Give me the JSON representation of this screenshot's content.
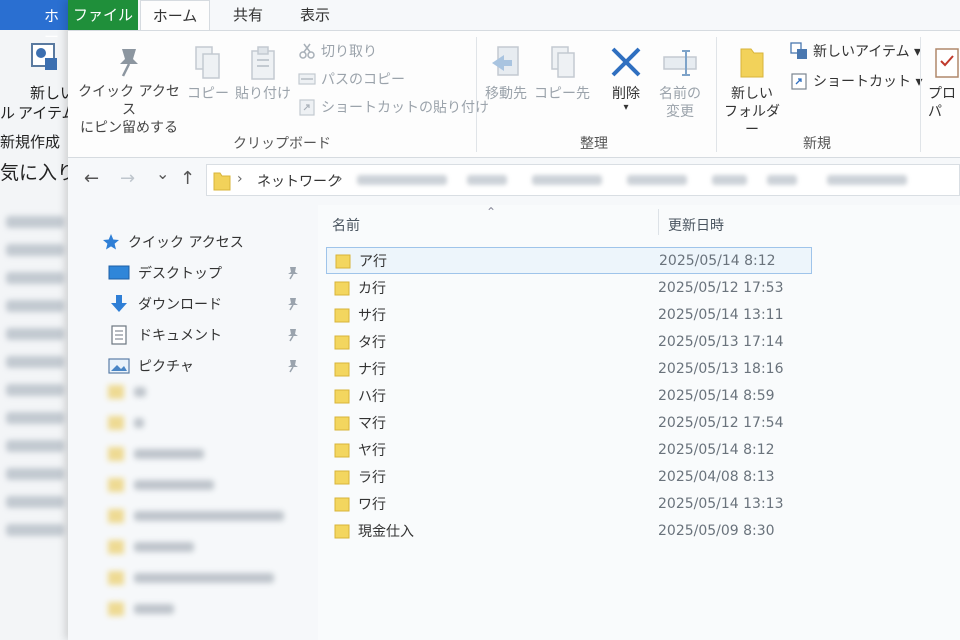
{
  "background_window": {
    "tab_label": "ホー",
    "button_label_line1": "新しい",
    "button_label_line2": "アイテム",
    "left_partial_text": "ル",
    "group_label": "新規作成",
    "nav_text": "気に入り"
  },
  "ribbon": {
    "tabs": {
      "file": "ファイル",
      "home": "ホーム",
      "share": "共有",
      "view": "表示"
    },
    "clipboard": {
      "pin_label_line1": "クイック アクセス",
      "pin_label_line2": "にピン留めする",
      "copy_label": "コピー",
      "paste_label": "貼り付け",
      "cut_label": "切り取り",
      "copy_path_label": "パスのコピー",
      "paste_shortcut_label": "ショートカットの貼り付け",
      "group_label": "クリップボード"
    },
    "organize": {
      "move_to_label": "移動先",
      "copy_to_label": "コピー先",
      "delete_label": "削除",
      "rename_label_line1": "名前の",
      "rename_label_line2": "変更",
      "group_label": "整理"
    },
    "new": {
      "new_folder_line1": "新しい",
      "new_folder_line2": "フォルダー",
      "new_item_label": "新しいアイテム ▾",
      "shortcut_label": "ショートカット ▾",
      "group_label": "新規"
    },
    "open": {
      "properties_label": "プロパ"
    }
  },
  "navigation": {
    "back_glyph": "←",
    "forward_glyph": "→",
    "recent_glyph": "⌄",
    "up_glyph": "↑"
  },
  "address_bar": {
    "separator": "›",
    "root": "ネットワーク"
  },
  "nav_pane": {
    "quick_access": "クイック アクセス",
    "items": [
      {
        "label": "デスクトップ"
      },
      {
        "label": "ダウンロード"
      },
      {
        "label": "ドキュメント"
      },
      {
        "label": "ピクチャ"
      }
    ]
  },
  "file_list": {
    "columns": {
      "name": "名前",
      "modified": "更新日時"
    },
    "sort_glyph": "⌃",
    "rows": [
      {
        "name": "ア行",
        "modified": "2025/05/14 8:12"
      },
      {
        "name": "カ行",
        "modified": "2025/05/12 17:53"
      },
      {
        "name": "サ行",
        "modified": "2025/05/14 13:11"
      },
      {
        "name": "タ行",
        "modified": "2025/05/13 17:14"
      },
      {
        "name": "ナ行",
        "modified": "2025/05/13 18:16"
      },
      {
        "name": "ハ行",
        "modified": "2025/05/14 8:59"
      },
      {
        "name": "マ行",
        "modified": "2025/05/12 17:54"
      },
      {
        "name": "ヤ行",
        "modified": "2025/05/14 8:12"
      },
      {
        "name": "ラ行",
        "modified": "2025/04/08 8:13"
      },
      {
        "name": "ワ行",
        "modified": "2025/05/14 13:13"
      },
      {
        "name": "現金仕入",
        "modified": "2025/05/09 8:30"
      }
    ]
  }
}
